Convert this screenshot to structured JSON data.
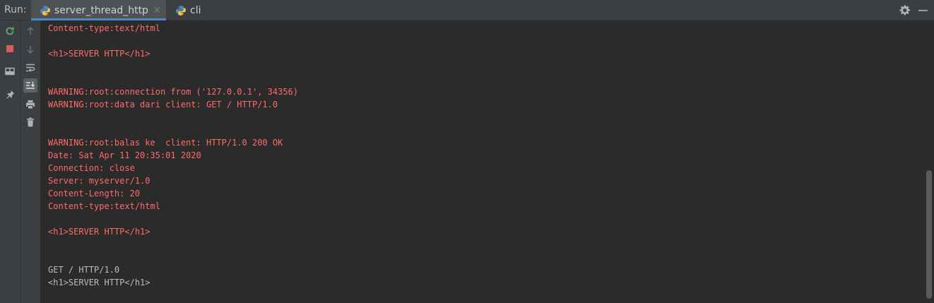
{
  "header": {
    "run_label": "Run:",
    "tabs": [
      {
        "label": "server_thread_http",
        "active": true,
        "close": "×"
      },
      {
        "label": "cli",
        "active": false
      }
    ]
  },
  "icons": {
    "tab": "python-icon",
    "settings": "gear-icon",
    "hide": "minimize-icon",
    "left_toolbar": [
      "rerun-icon",
      "stop-icon",
      "layout-icon",
      "pin-icon"
    ],
    "right_toolbar": [
      "arrow-up-icon",
      "arrow-down-icon",
      "soft-wrap-icon",
      "scroll-to-end-icon",
      "print-icon",
      "trash-icon"
    ]
  },
  "colors": {
    "stderr": "#ff6b68",
    "stdout": "#bbbbbb",
    "accent": "#4a88c7",
    "rerun": "#59a869",
    "stop": "#db5c5c"
  },
  "console": {
    "lines": [
      {
        "text": "Content-type:text/html",
        "stream": "stderr"
      },
      {
        "text": "",
        "stream": "stderr"
      },
      {
        "text": "<h1>SERVER HTTP</h1>",
        "stream": "stderr"
      },
      {
        "text": "",
        "stream": "stderr"
      },
      {
        "text": "",
        "stream": "stderr"
      },
      {
        "text": "WARNING:root:connection from ('127.0.0.1', 34356)",
        "stream": "stderr"
      },
      {
        "text": "WARNING:root:data dari client: GET / HTTP/1.0",
        "stream": "stderr"
      },
      {
        "text": "",
        "stream": "stderr"
      },
      {
        "text": "",
        "stream": "stderr"
      },
      {
        "text": "WARNING:root:balas ke  client: HTTP/1.0 200 OK",
        "stream": "stderr"
      },
      {
        "text": "Date: Sat Apr 11 20:35:01 2020",
        "stream": "stderr"
      },
      {
        "text": "Connection: close",
        "stream": "stderr"
      },
      {
        "text": "Server: myserver/1.0",
        "stream": "stderr"
      },
      {
        "text": "Content-Length: 20",
        "stream": "stderr"
      },
      {
        "text": "Content-type:text/html",
        "stream": "stderr"
      },
      {
        "text": "",
        "stream": "stderr"
      },
      {
        "text": "<h1>SERVER HTTP</h1>",
        "stream": "stderr"
      },
      {
        "text": "",
        "stream": "stderr"
      },
      {
        "text": "",
        "stream": "stderr"
      },
      {
        "text": "GET / HTTP/1.0",
        "stream": "stdout"
      },
      {
        "text": "<h1>SERVER HTTP</h1>",
        "stream": "stdout"
      }
    ]
  }
}
